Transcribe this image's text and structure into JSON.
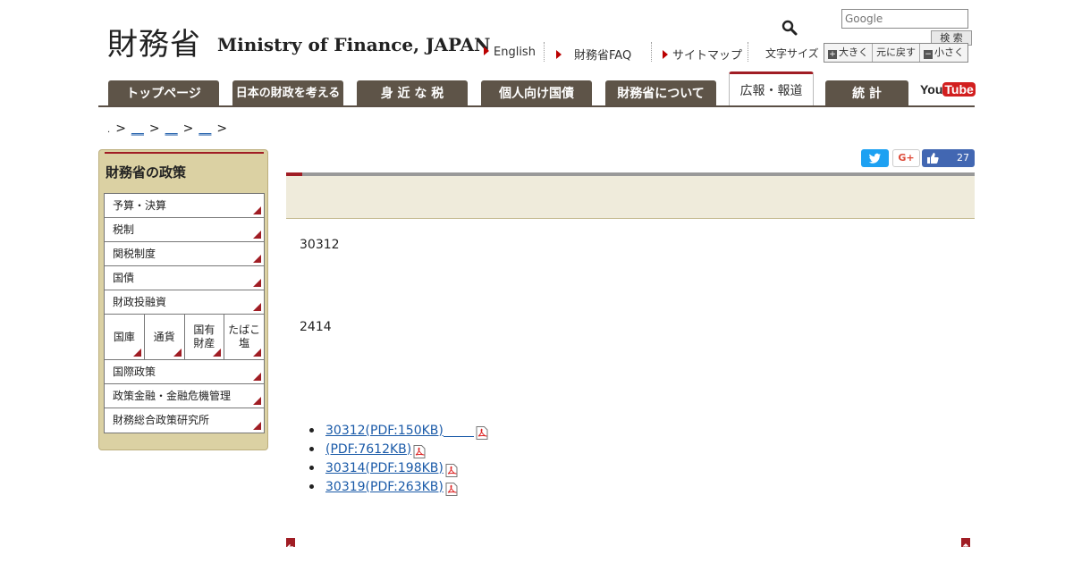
{
  "header": {
    "logo_kanji": "財務省",
    "logo_en": "Ministry of Finance, JAPAN",
    "search_placeholder": "Google",
    "search_button": "検 索",
    "util_links": [
      "English",
      "財務省FAQ",
      "サイトマップ"
    ],
    "fontsize_label": "文字サイズ",
    "fontsize_buttons": {
      "larger": "大きく",
      "reset": "元に戻す",
      "smaller": "小さく"
    }
  },
  "nav": {
    "tabs": [
      "トップページ",
      "日本の財政を考える",
      "身 近 な 税",
      "個人向け国債",
      "財務省について",
      "広報・報道",
      "統 計"
    ],
    "active_index": 5,
    "youtube_you": "You",
    "youtube_tube": "Tube"
  },
  "breadcrumb": {
    "lead": ".",
    "sep": ">",
    "items": [
      "__",
      "__",
      "__"
    ]
  },
  "sidebar": {
    "title": "財務省の政策",
    "items_top": [
      "予算・決算",
      "税制",
      "関税制度",
      "国債",
      "財政投融資"
    ],
    "grid": [
      "国庫",
      "通貨",
      "国有\n財産",
      "たばこ\n塩"
    ],
    "items_bottom": [
      "国際政策",
      "政策金融・金融危機管理",
      "財務総合政策研究所"
    ]
  },
  "social": {
    "gplus": "G+",
    "fb_count": "27"
  },
  "main": {
    "para1": "30312",
    "para2": "2414",
    "files": [
      "30312(PDF:150KB)",
      "(PDF:7612KB)",
      "30314(PDF:198KB)",
      "30319(PDF:263KB)"
    ]
  },
  "colors": {
    "accent_red": "#a01d24",
    "nav_brown": "#5e5448",
    "sidebar_tan": "#dbd1a3",
    "link_blue": "#1a5aa8"
  }
}
